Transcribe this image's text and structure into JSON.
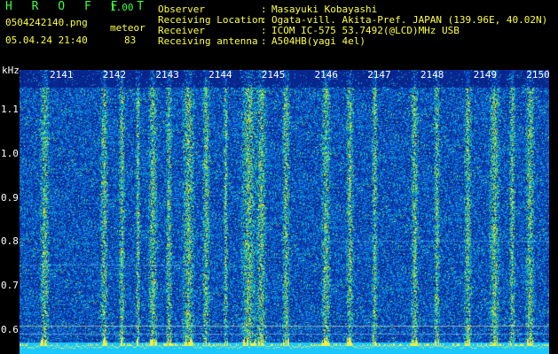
{
  "header": {
    "app_title": "H R O F F T",
    "app_version": "1.00",
    "file_name": "0504242140.png",
    "mode": "meteor",
    "timestamp": "05.04.24 21:40",
    "count": "83"
  },
  "info": [
    {
      "key": "Observer",
      "value": "Masayuki Kobayashi"
    },
    {
      "key": "Receiving Location",
      "value": "Ogata-vill. Akita-Pref. JAPAN (139.96E, 40.02N)"
    },
    {
      "key": "Receiver",
      "value": "ICOM IC-575 53.7492(@LCD)MHz USB"
    },
    {
      "key": "Receiving antenna",
      "value": "A504HB(yagi 4el)"
    }
  ],
  "axes": {
    "y_unit": "kHz",
    "x_ticks": [
      "2141",
      "2142",
      "2143",
      "2144",
      "2145",
      "2146",
      "2147",
      "2148",
      "2149",
      "2150"
    ],
    "y_ticks": [
      "1.1",
      "1.0",
      "0.9",
      "0.8",
      "0.7",
      "0.6"
    ]
  },
  "colors": {
    "background": "#000000",
    "header_green": "#3cff3c",
    "header_yellow": "#ffff40",
    "base_blue": "#0a2a8c",
    "cursor_line": "#ffff80"
  }
}
